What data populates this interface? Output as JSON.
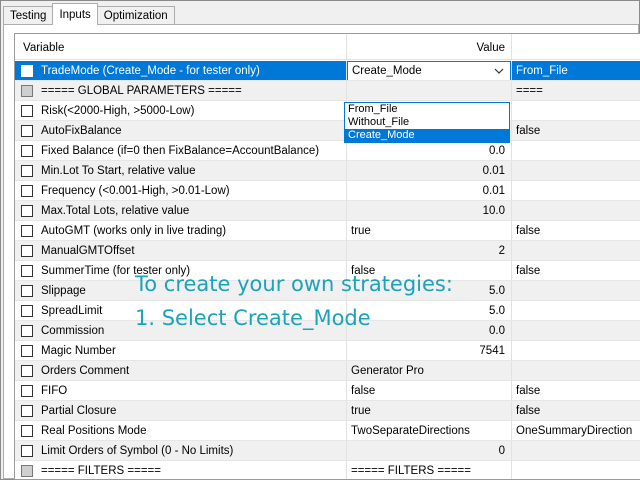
{
  "tabs": [
    {
      "label": "Testing",
      "active": false
    },
    {
      "label": "Inputs",
      "active": true
    },
    {
      "label": "Optimization",
      "active": false
    }
  ],
  "grid": {
    "header": {
      "variable": "Variable",
      "value": "Value"
    },
    "rows": [
      {
        "name": "TradeMode (Create_Mode - for tester only)",
        "value": "Create_Mode",
        "start": "From_File"
      },
      {
        "name": "===== GLOBAL PARAMETERS =====",
        "value": "",
        "start": "===="
      },
      {
        "name": "Risk(<2000-High, >5000-Low)",
        "value": "",
        "start": ""
      },
      {
        "name": "AutoFixBalance",
        "value": "false",
        "start": "false"
      },
      {
        "name": "Fixed Balance (if=0 then FixBalance=AccountBalance)",
        "value": "0.0",
        "start": ""
      },
      {
        "name": "Min.Lot To Start, relative value",
        "value": "0.01",
        "start": ""
      },
      {
        "name": "Frequency (<0.001-High, >0.01-Low)",
        "value": "0.01",
        "start": ""
      },
      {
        "name": "Max.Total Lots, relative value",
        "value": "10.0",
        "start": ""
      },
      {
        "name": "AutoGMT (works only in live trading)",
        "value": "true",
        "start": "false"
      },
      {
        "name": "ManualGMTOffset",
        "value": "2",
        "start": ""
      },
      {
        "name": "SummerTime (for tester only)",
        "value": "false",
        "start": "false"
      },
      {
        "name": "Slippage",
        "value": "5.0",
        "start": ""
      },
      {
        "name": "SpreadLimit",
        "value": "5.0",
        "start": ""
      },
      {
        "name": "Commission",
        "value": "0.0",
        "start": ""
      },
      {
        "name": "Magic Number",
        "value": "7541",
        "start": ""
      },
      {
        "name": "Orders Comment",
        "value": "Generator Pro",
        "start": ""
      },
      {
        "name": "FIFO",
        "value": "false",
        "start": "false"
      },
      {
        "name": "Partial Closure",
        "value": "true",
        "start": "false"
      },
      {
        "name": "Real Positions Mode",
        "value": "TwoSeparateDirections",
        "start": "OneSummaryDirection"
      },
      {
        "name": "Limit Orders of Symbol (0 - No Limits)",
        "value": "0",
        "start": ""
      },
      {
        "name": "=====    FILTERS    =====",
        "value": "=====    FILTERS    =====",
        "start": ""
      }
    ]
  },
  "dropdown": {
    "options": [
      "From_File",
      "Without_File",
      "Create_Mode"
    ],
    "highlighted": "Create_Mode"
  },
  "overlay": {
    "line1": "To create your own strategies:",
    "line2": "1. Select Create_Mode"
  },
  "colors": {
    "selection": "#0078d7",
    "overlay_text": "#1ba3b8"
  },
  "icons": {
    "checkbox": "checkbox-icon",
    "combo": "chevron-down-icon"
  }
}
